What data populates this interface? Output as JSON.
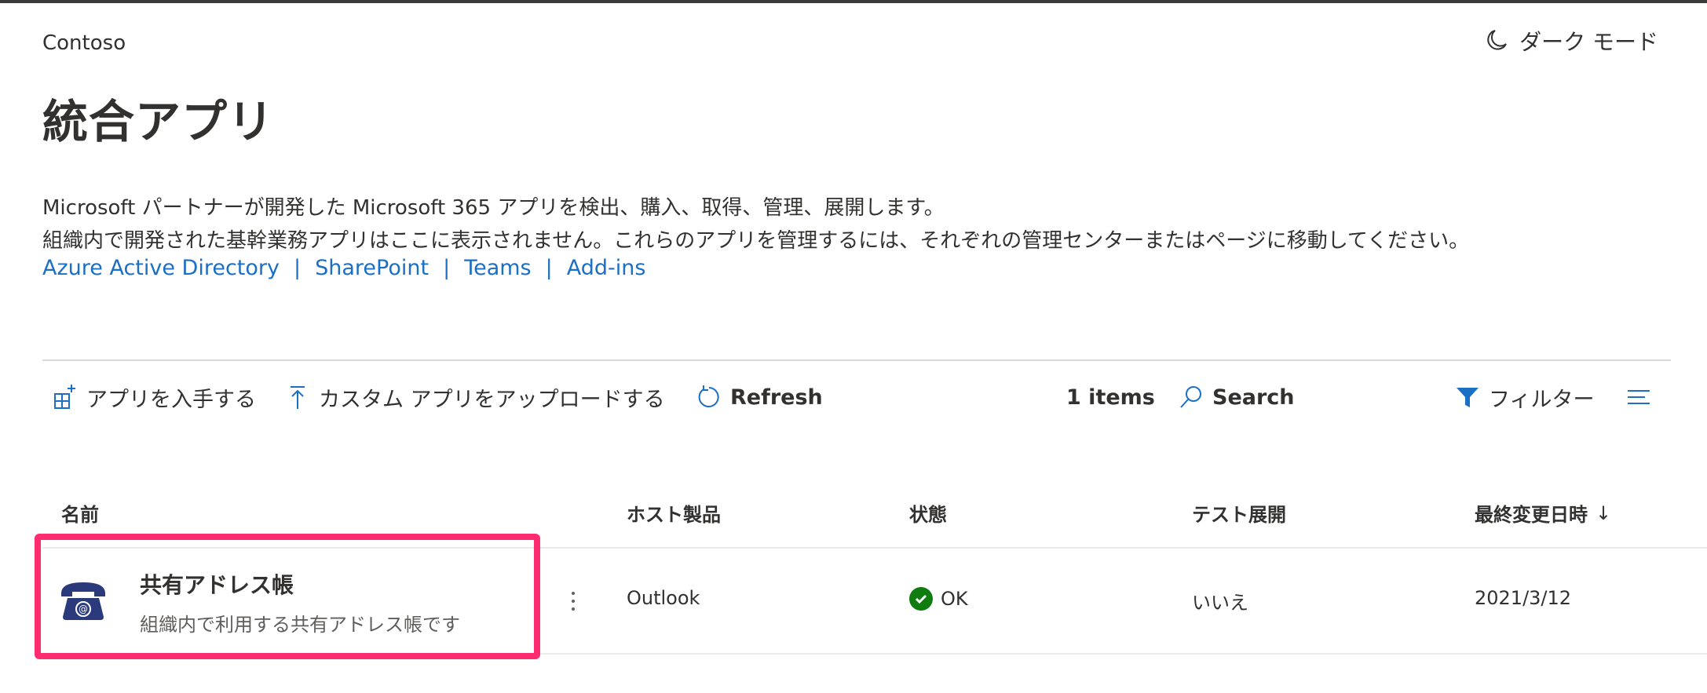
{
  "header": {
    "org_name": "Contoso",
    "dark_mode_label": "ダーク モード",
    "page_title": "統合アプリ"
  },
  "description": {
    "line1": "Microsoft パートナーが開発した Microsoft 365 アプリを検出、購入、取得、管理、展開します。",
    "line2": "組織内で開発された基幹業務アプリはここに表示されません。これらのアプリを管理するには、それぞれの管理センターまたはページに移動してください。",
    "links": [
      "Azure Active Directory",
      "SharePoint",
      "Teams",
      "Add-ins"
    ],
    "separator": "|"
  },
  "toolbar": {
    "get_apps": "アプリを入手する",
    "upload_custom": "カスタム アプリをアップロードする",
    "refresh": "Refresh",
    "item_count": "1 items",
    "search": "Search",
    "filter": "フィルター"
  },
  "table": {
    "columns": [
      "名前",
      "ホスト製品",
      "状態",
      "テスト展開",
      "最終変更日時"
    ],
    "sort_indicator": "↓",
    "rows": [
      {
        "name": "共有アドレス帳",
        "description": "組織内で利用する共有アドレス帳です",
        "host": "Outlook",
        "status": "OK",
        "test_deploy": "いいえ",
        "modified": "2021/3/12"
      }
    ]
  },
  "colors": {
    "link": "#1b6fc4",
    "status_ok": "#107c10",
    "highlight": "#ff2d6f",
    "app_icon": "#2b3a7a"
  },
  "icons": {
    "dark_mode": "moon-icon",
    "get_apps": "grid-add-icon",
    "upload": "upload-arrow-icon",
    "refresh": "refresh-icon",
    "search": "search-icon",
    "filter": "filter-icon",
    "view": "list-view-icon",
    "app": "telephone-icon",
    "status": "check-circle-icon"
  }
}
